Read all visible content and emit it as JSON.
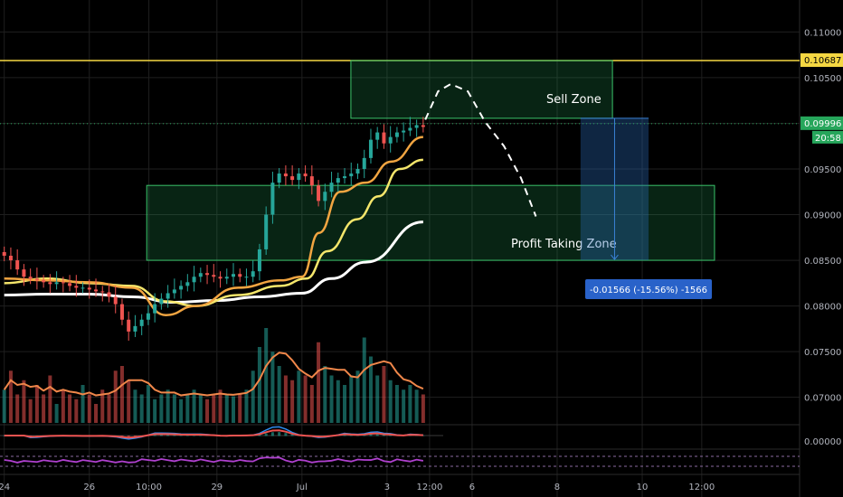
{
  "chart_data": {
    "type": "candlestick",
    "y_axis": {
      "ticks": [
        "0.11000",
        "0.10500",
        "0.10000",
        "0.09500",
        "0.09000",
        "0.08500",
        "0.08000",
        "0.07500",
        "0.07000"
      ],
      "tick_values": [
        0.11,
        0.105,
        0.1,
        0.095,
        0.09,
        0.085,
        0.08,
        0.075,
        0.07
      ],
      "range": [
        0.067,
        0.1135
      ]
    },
    "osc_axis": {
      "ticks": [
        "0.00000"
      ]
    },
    "x_axis": {
      "ticks": [
        "24",
        "26",
        "10:00",
        "29",
        "Jul",
        "3",
        "12:00",
        "6",
        "8",
        "10",
        "12:00"
      ],
      "tick_positions": [
        0,
        2,
        3.4,
        5,
        7,
        9,
        10,
        11,
        13,
        15,
        16.4
      ],
      "range": [
        -0.1,
        18.7
      ]
    },
    "price_labels": [
      {
        "id": "horizontal",
        "text": "0.10687",
        "value": 0.10687,
        "color": "#f5d742"
      },
      {
        "id": "last",
        "text": "0.09996",
        "value": 0.09996,
        "color": "#26a65b"
      },
      {
        "id": "countdown",
        "text": "20:58",
        "color": "#26a65b"
      }
    ],
    "candles": {
      "x_start": 0,
      "x_end": 9.85,
      "closes": [
        0.0855,
        0.085,
        0.084,
        0.0832,
        0.083,
        0.0828,
        0.0826,
        0.0824,
        0.0826,
        0.0825,
        0.0822,
        0.082,
        0.082,
        0.0818,
        0.0816,
        0.0815,
        0.081,
        0.0802,
        0.0785,
        0.0772,
        0.0778,
        0.0785,
        0.0792,
        0.0802,
        0.0808,
        0.0814,
        0.0818,
        0.0822,
        0.0826,
        0.0832,
        0.0836,
        0.0834,
        0.0832,
        0.083,
        0.0832,
        0.0835,
        0.0832,
        0.0832,
        0.0838,
        0.0862,
        0.09,
        0.0935,
        0.0945,
        0.0942,
        0.0938,
        0.0945,
        0.0942,
        0.0932,
        0.0915,
        0.0925,
        0.0935,
        0.094,
        0.0942,
        0.0945,
        0.095,
        0.0962,
        0.0982,
        0.099,
        0.0978,
        0.0985,
        0.099,
        0.0992,
        0.0995,
        0.0998,
        0.0996
      ]
    },
    "volume": {
      "values": [
        0.35,
        0.55,
        0.3,
        0.45,
        0.25,
        0.4,
        0.3,
        0.5,
        0.2,
        0.35,
        0.3,
        0.25,
        0.4,
        0.3,
        0.2,
        0.35,
        0.3,
        0.55,
        0.6,
        0.45,
        0.35,
        0.3,
        0.4,
        0.25,
        0.3,
        0.35,
        0.3,
        0.25,
        0.3,
        0.35,
        0.3,
        0.25,
        0.3,
        0.35,
        0.3,
        0.28,
        0.3,
        0.35,
        0.55,
        0.8,
        1.0,
        0.75,
        0.6,
        0.5,
        0.45,
        0.55,
        0.5,
        0.4,
        0.85,
        0.6,
        0.5,
        0.45,
        0.4,
        0.5,
        0.55,
        0.9,
        0.7,
        0.5,
        0.6,
        0.45,
        0.4,
        0.35,
        0.4,
        0.35,
        0.3
      ]
    },
    "moving_averages": [
      {
        "color": "#ffffff",
        "points": [
          [
            0,
            0.0812
          ],
          [
            1,
            0.0813
          ],
          [
            2,
            0.0813
          ],
          [
            3,
            0.081
          ],
          [
            4,
            0.0804
          ],
          [
            5,
            0.0806
          ],
          [
            6,
            0.081
          ],
          [
            7,
            0.0814
          ],
          [
            7.7,
            0.083
          ],
          [
            8.5,
            0.0848
          ],
          [
            9.85,
            0.0892
          ]
        ]
      },
      {
        "color": "#f5e66b",
        "points": [
          [
            0,
            0.0825
          ],
          [
            1,
            0.083
          ],
          [
            2,
            0.0825
          ],
          [
            3,
            0.0822
          ],
          [
            3.8,
            0.0805
          ],
          [
            4.5,
            0.08
          ],
          [
            5.5,
            0.0812
          ],
          [
            6.5,
            0.0822
          ],
          [
            7.1,
            0.083
          ],
          [
            7.6,
            0.086
          ],
          [
            8.3,
            0.0895
          ],
          [
            8.8,
            0.092
          ],
          [
            9.3,
            0.095
          ],
          [
            9.85,
            0.096
          ]
        ]
      },
      {
        "color": "#f2a541",
        "points": [
          [
            0,
            0.083
          ],
          [
            1,
            0.0828
          ],
          [
            2,
            0.0826
          ],
          [
            3,
            0.082
          ],
          [
            3.8,
            0.079
          ],
          [
            4.5,
            0.08
          ],
          [
            5.5,
            0.082
          ],
          [
            6.5,
            0.0828
          ],
          [
            7.0,
            0.0832
          ],
          [
            7.4,
            0.088
          ],
          [
            7.9,
            0.0925
          ],
          [
            8.5,
            0.0935
          ],
          [
            9.1,
            0.0958
          ],
          [
            9.85,
            0.0985
          ]
        ]
      }
    ],
    "annotations": [
      {
        "type": "horizontal_line",
        "value": 0.10687,
        "color": "#f5d742"
      },
      {
        "type": "rectangle",
        "label": "Sell Zone",
        "x1": 8.15,
        "x2": 14.3,
        "y1": 0.10055,
        "y2": 0.10687,
        "color": "#26a65b"
      },
      {
        "type": "rectangle",
        "label": "Profit Taking Zone",
        "x1": 3.35,
        "x2": 16.7,
        "y1": 0.085,
        "y2": 0.0932,
        "color": "#26a65b"
      },
      {
        "type": "dashed_path",
        "points": [
          [
            9.9,
            0.1004
          ],
          [
            10.2,
            0.1035
          ],
          [
            10.5,
            0.1043
          ],
          [
            10.9,
            0.1035
          ],
          [
            11.3,
            0.1002
          ],
          [
            11.75,
            0.0975
          ],
          [
            12.15,
            0.094
          ],
          [
            12.5,
            0.0898
          ]
        ],
        "color": "#ffffff"
      },
      {
        "type": "short_position",
        "x1": 13.55,
        "x2": 15.15,
        "entry": 0.10055,
        "stop": 0.085,
        "label": "-0.01566 (-15.56%) -1566"
      }
    ],
    "oscillator_band": {
      "upper_dashed": true,
      "lower_dashed": true,
      "color": "#b040d0"
    }
  }
}
